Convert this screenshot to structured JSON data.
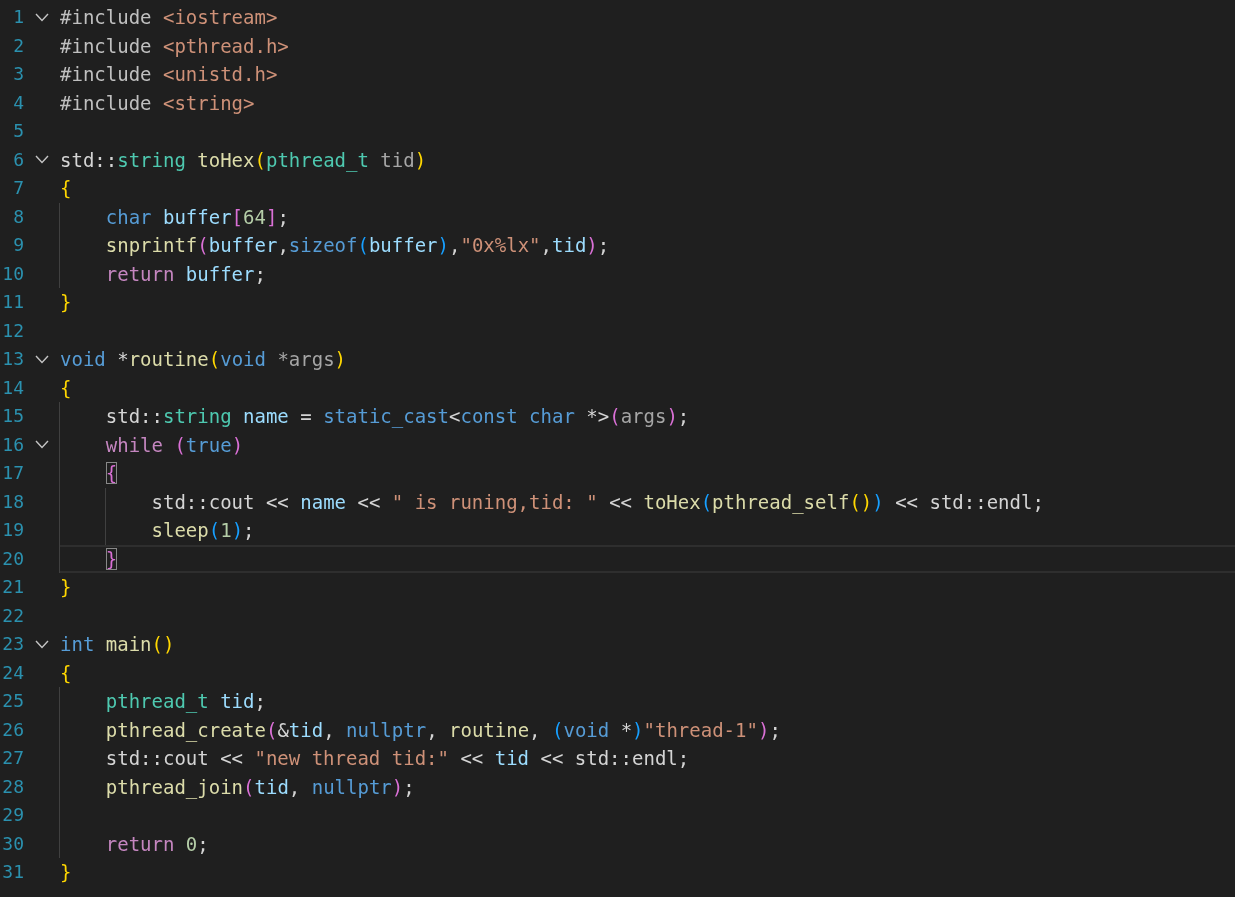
{
  "editor": {
    "lines": [
      {
        "number": "1",
        "fold": true,
        "current": false,
        "bracket_match": false,
        "tokens": [
          {
            "kind": "directive",
            "text": "#include "
          },
          {
            "kind": "header",
            "text": "<iostream>"
          }
        ]
      },
      {
        "number": "2",
        "fold": false,
        "current": false,
        "bracket_match": false,
        "tokens": [
          {
            "kind": "directive",
            "text": "#include "
          },
          {
            "kind": "header",
            "text": "<pthread.h>"
          }
        ]
      },
      {
        "number": "3",
        "fold": false,
        "current": false,
        "bracket_match": false,
        "tokens": [
          {
            "kind": "directive",
            "text": "#include "
          },
          {
            "kind": "header",
            "text": "<unistd.h>"
          }
        ]
      },
      {
        "number": "4",
        "fold": false,
        "current": false,
        "bracket_match": false,
        "tokens": [
          {
            "kind": "directive",
            "text": "#include "
          },
          {
            "kind": "header",
            "text": "<string>"
          }
        ]
      },
      {
        "number": "5",
        "fold": false,
        "current": false,
        "bracket_match": false,
        "guide": false
      },
      {
        "number": "6",
        "fold": true,
        "current": false,
        "bracket_match": false,
        "tokens": [
          {
            "kind": "plain",
            "text": "std::"
          },
          {
            "kind": "type",
            "text": "string"
          },
          {
            "kind": "func",
            "text": " toHex"
          },
          {
            "kind": "b1",
            "text": "("
          },
          {
            "kind": "type",
            "text": "pthread_t"
          },
          {
            "kind": "param",
            "text": " tid"
          },
          {
            "kind": "b1",
            "text": ")"
          }
        ]
      },
      {
        "number": "7",
        "fold": false,
        "current": false,
        "bracket_match": false,
        "tokens": [
          {
            "kind": "b1",
            "text": "{"
          }
        ]
      },
      {
        "number": "8",
        "fold": false,
        "current": false,
        "bracket_match": false,
        "tokens": [
          {
            "kind": "keyword",
            "text": "    char"
          },
          {
            "kind": "var",
            "text": " buffer"
          },
          {
            "kind": "b2",
            "text": "["
          },
          {
            "kind": "number",
            "text": "64"
          },
          {
            "kind": "b2",
            "text": "]"
          },
          {
            "kind": "plain",
            "text": ";"
          }
        ]
      },
      {
        "number": "9",
        "fold": false,
        "current": false,
        "bracket_match": false,
        "tokens": [
          {
            "kind": "func",
            "text": "    snprintf"
          },
          {
            "kind": "b2",
            "text": "("
          },
          {
            "kind": "var",
            "text": "buffer"
          },
          {
            "kind": "plain",
            "text": ","
          },
          {
            "kind": "keyword",
            "text": "sizeof"
          },
          {
            "kind": "b3",
            "text": "("
          },
          {
            "kind": "var",
            "text": "buffer"
          },
          {
            "kind": "b3",
            "text": ")"
          },
          {
            "kind": "plain",
            "text": ","
          },
          {
            "kind": "string",
            "text": "\"0x%lx\""
          },
          {
            "kind": "plain",
            "text": ","
          },
          {
            "kind": "var",
            "text": "tid"
          },
          {
            "kind": "b2",
            "text": ")"
          },
          {
            "kind": "plain",
            "text": ";"
          }
        ]
      },
      {
        "number": "10",
        "fold": false,
        "current": false,
        "bracket_match": false,
        "tokens": [
          {
            "kind": "control",
            "text": "    return"
          },
          {
            "kind": "var",
            "text": " buffer"
          },
          {
            "kind": "plain",
            "text": ";"
          }
        ]
      },
      {
        "number": "11",
        "fold": false,
        "current": false,
        "bracket_match": false,
        "tokens": [
          {
            "kind": "b1",
            "text": "}"
          }
        ]
      },
      {
        "number": "12",
        "fold": false,
        "current": false,
        "bracket_match": false,
        "guide": false
      },
      {
        "number": "13",
        "fold": true,
        "current": false,
        "bracket_match": false,
        "tokens": [
          {
            "kind": "keyword",
            "text": "void"
          },
          {
            "kind": "plain",
            "text": " *"
          },
          {
            "kind": "func",
            "text": "routine"
          },
          {
            "kind": "b1",
            "text": "("
          },
          {
            "kind": "keyword",
            "text": "void"
          },
          {
            "kind": "param",
            "text": " *args"
          },
          {
            "kind": "b1",
            "text": ")"
          }
        ]
      },
      {
        "number": "14",
        "fold": false,
        "current": false,
        "bracket_match": false,
        "tokens": [
          {
            "kind": "b1",
            "text": "{"
          }
        ]
      },
      {
        "number": "15",
        "fold": false,
        "current": false,
        "bracket_match": false,
        "tokens": [
          {
            "kind": "plain",
            "text": "    std::"
          },
          {
            "kind": "type",
            "text": "string"
          },
          {
            "kind": "var",
            "text": " name"
          },
          {
            "kind": "plain",
            "text": " = "
          },
          {
            "kind": "keyword",
            "text": "static_cast"
          },
          {
            "kind": "plain",
            "text": "<"
          },
          {
            "kind": "keyword",
            "text": "const"
          },
          {
            "kind": "keyword",
            "text": " char"
          },
          {
            "kind": "plain",
            "text": " *>"
          },
          {
            "kind": "b2",
            "text": "("
          },
          {
            "kind": "param",
            "text": "args"
          },
          {
            "kind": "b2",
            "text": ")"
          },
          {
            "kind": "plain",
            "text": ";"
          }
        ]
      },
      {
        "number": "16",
        "fold": true,
        "current": false,
        "bracket_match": false,
        "tokens": [
          {
            "kind": "control",
            "text": "    while"
          },
          {
            "kind": "b2",
            "text": " ("
          },
          {
            "kind": "keyword",
            "text": "true"
          },
          {
            "kind": "b2",
            "text": ")"
          }
        ]
      },
      {
        "number": "17",
        "fold": false,
        "current": false,
        "bracket_match": true,
        "tokens": [
          {
            "kind": "b2",
            "text": "    {"
          }
        ]
      },
      {
        "number": "18",
        "fold": false,
        "current": false,
        "bracket_match": false,
        "tokens": [
          {
            "kind": "plain",
            "text": "        std::cout << "
          },
          {
            "kind": "var",
            "text": "name"
          },
          {
            "kind": "plain",
            "text": " << "
          },
          {
            "kind": "string",
            "text": "\" is runing,tid: \""
          },
          {
            "kind": "plain",
            "text": " << "
          },
          {
            "kind": "func",
            "text": "toHex"
          },
          {
            "kind": "b3",
            "text": "("
          },
          {
            "kind": "func",
            "text": "pthread_self"
          },
          {
            "kind": "b1",
            "text": "()"
          },
          {
            "kind": "b3",
            "text": ")"
          },
          {
            "kind": "plain",
            "text": " << std::endl;"
          }
        ]
      },
      {
        "number": "19",
        "fold": false,
        "current": false,
        "bracket_match": false,
        "tokens": [
          {
            "kind": "func",
            "text": "        sleep"
          },
          {
            "kind": "b3",
            "text": "("
          },
          {
            "kind": "number",
            "text": "1"
          },
          {
            "kind": "b3",
            "text": ")"
          },
          {
            "kind": "plain",
            "text": ";"
          }
        ]
      },
      {
        "number": "20",
        "fold": false,
        "current": true,
        "bracket_match": true,
        "tokens": [
          {
            "kind": "b2",
            "text": "    }"
          }
        ]
      },
      {
        "number": "21",
        "fold": false,
        "current": false,
        "bracket_match": false,
        "tokens": [
          {
            "kind": "b1",
            "text": "}"
          }
        ]
      },
      {
        "number": "22",
        "fold": false,
        "current": false,
        "bracket_match": false,
        "guide": false
      },
      {
        "number": "23",
        "fold": true,
        "current": false,
        "bracket_match": false,
        "tokens": [
          {
            "kind": "keyword",
            "text": "int"
          },
          {
            "kind": "func",
            "text": " main"
          },
          {
            "kind": "b1",
            "text": "()"
          }
        ]
      },
      {
        "number": "24",
        "fold": false,
        "current": false,
        "bracket_match": false,
        "tokens": [
          {
            "kind": "b1",
            "text": "{"
          }
        ]
      },
      {
        "number": "25",
        "fold": false,
        "current": false,
        "bracket_match": false,
        "tokens": [
          {
            "kind": "type",
            "text": "    pthread_t"
          },
          {
            "kind": "var",
            "text": " tid"
          },
          {
            "kind": "plain",
            "text": ";"
          }
        ]
      },
      {
        "number": "26",
        "fold": false,
        "current": false,
        "bracket_match": false,
        "tokens": [
          {
            "kind": "func",
            "text": "    pthread_create"
          },
          {
            "kind": "b2",
            "text": "("
          },
          {
            "kind": "plain",
            "text": "&"
          },
          {
            "kind": "var",
            "text": "tid"
          },
          {
            "kind": "plain",
            "text": ", "
          },
          {
            "kind": "keyword",
            "text": "nullptr"
          },
          {
            "kind": "plain",
            "text": ", "
          },
          {
            "kind": "func",
            "text": "routine"
          },
          {
            "kind": "plain",
            "text": ", "
          },
          {
            "kind": "b3",
            "text": "("
          },
          {
            "kind": "keyword",
            "text": "void"
          },
          {
            "kind": "plain",
            "text": " *"
          },
          {
            "kind": "b3",
            "text": ")"
          },
          {
            "kind": "string",
            "text": "\"thread-1\""
          },
          {
            "kind": "b2",
            "text": ")"
          },
          {
            "kind": "plain",
            "text": ";"
          }
        ]
      },
      {
        "number": "27",
        "fold": false,
        "current": false,
        "bracket_match": false,
        "tokens": [
          {
            "kind": "plain",
            "text": "    std::cout << "
          },
          {
            "kind": "string",
            "text": "\"new thread tid:\""
          },
          {
            "kind": "plain",
            "text": " << "
          },
          {
            "kind": "var",
            "text": "tid"
          },
          {
            "kind": "plain",
            "text": " << std::endl;"
          }
        ]
      },
      {
        "number": "28",
        "fold": false,
        "current": false,
        "bracket_match": false,
        "tokens": [
          {
            "kind": "func",
            "text": "    pthread_join"
          },
          {
            "kind": "b2",
            "text": "("
          },
          {
            "kind": "var",
            "text": "tid"
          },
          {
            "kind": "plain",
            "text": ", "
          },
          {
            "kind": "keyword",
            "text": "nullptr"
          },
          {
            "kind": "b2",
            "text": ")"
          },
          {
            "kind": "plain",
            "text": ";"
          }
        ]
      },
      {
        "number": "29",
        "fold": false,
        "current": false,
        "bracket_match": false,
        "guide": true
      },
      {
        "number": "30",
        "fold": false,
        "current": false,
        "bracket_match": false,
        "tokens": [
          {
            "kind": "control",
            "text": "    return"
          },
          {
            "kind": "number",
            "text": " 0"
          },
          {
            "kind": "plain",
            "text": ";"
          }
        ]
      },
      {
        "number": "31",
        "fold": false,
        "current": false,
        "bracket_match": false,
        "tokens": [
          {
            "kind": "b1",
            "text": "}"
          }
        ]
      }
    ]
  }
}
